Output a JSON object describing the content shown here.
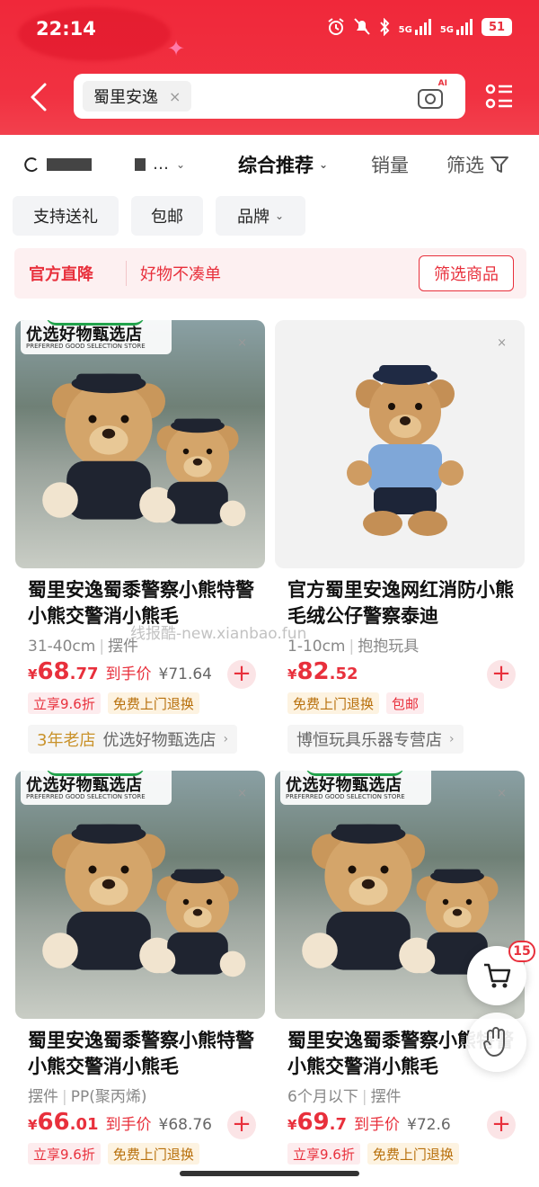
{
  "status_bar": {
    "time": "22:14",
    "signal_1": "5G",
    "signal_2": "5G",
    "battery": "51"
  },
  "search": {
    "query_chip": "蜀里安逸",
    "clear_symbol": "×",
    "camera_badge": "AI"
  },
  "sort_bar": {
    "comprehensive": "综合推荐",
    "sales": "销量",
    "filter": "筛选"
  },
  "filter_chips": [
    "支持送礼",
    "包邮",
    "品牌"
  ],
  "promo": {
    "title": "官方直降",
    "subtitle": "好物不凑单",
    "button": "筛选商品"
  },
  "store_badge": {
    "title": "优选好物甄选店",
    "subtitle": "PREFERRED GOOD SELECTION STORE"
  },
  "products": [
    {
      "title": "蜀里安逸蜀黍警察小熊特警小熊交警消小熊毛",
      "spec_1": "31-40cm",
      "spec_2": "摆件",
      "currency": "¥",
      "price_int": "68",
      "price_dec": ".77",
      "price_label": "到手价",
      "orig_price": "¥71.64",
      "tag_1": "立享9.6折",
      "tag_2": "免费上门退换",
      "shop_prefix": "3年老店",
      "shop_name": "优选好物甄选店"
    },
    {
      "title": "官方蜀里安逸网红消防小熊毛绒公仔警察泰迪",
      "spec_1": "1-10cm",
      "spec_2": "抱抱玩具",
      "currency": "¥",
      "price_int": "82",
      "price_dec": ".52",
      "tag_1": "免费上门退换",
      "tag_2": "包邮",
      "shop_name": "博恒玩具乐器专营店"
    },
    {
      "title": "蜀里安逸蜀黍警察小熊特警小熊交警消小熊毛",
      "spec_1": "摆件",
      "spec_2": "PP(聚丙烯)",
      "currency": "¥",
      "price_int": "66",
      "price_dec": ".01",
      "price_label": "到手价",
      "orig_price": "¥68.76",
      "tag_1": "立享9.6折",
      "tag_2": "免费上门退换"
    },
    {
      "title": "蜀里安逸蜀黍警察小熊特警小熊交警消小熊毛",
      "spec_1": "6个月以下",
      "spec_2": "摆件",
      "currency": "¥",
      "price_int": "69",
      "price_dec": ".7",
      "price_label": "到手价",
      "orig_price": "¥72.6",
      "tag_1": "立享9.6折",
      "tag_2": "免费上门退换"
    }
  ],
  "cart": {
    "count": "15"
  },
  "watermark": "线报酷-new.xianbao.fun",
  "colors": {
    "brand_red": "#e8303c",
    "header_red": "#f0283a"
  }
}
